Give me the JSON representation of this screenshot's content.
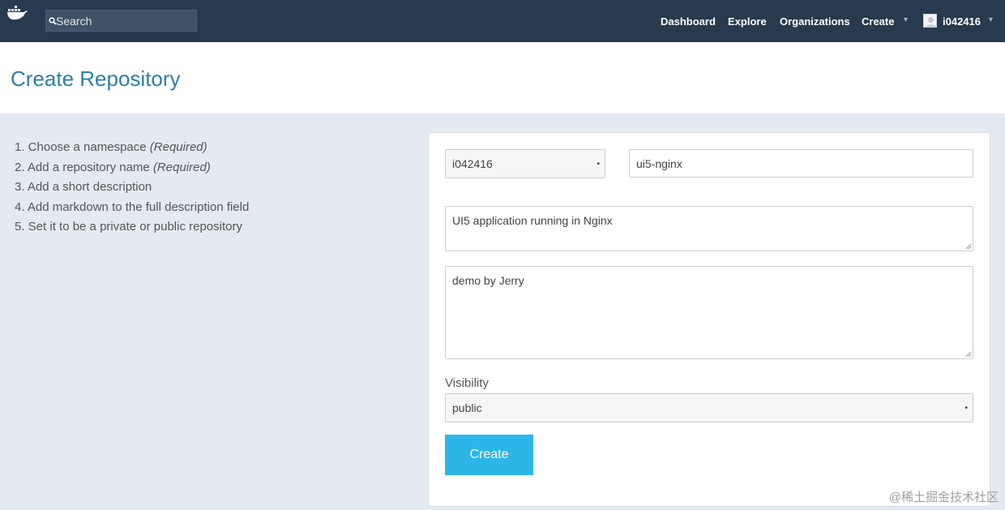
{
  "navbar": {
    "search_placeholder": "Search",
    "links": {
      "dashboard": "Dashboard",
      "explore": "Explore",
      "organizations": "Organizations",
      "create": "Create"
    },
    "username": "i042416"
  },
  "header": {
    "title": "Create Repository"
  },
  "steps": [
    {
      "text": "1. Choose a namespace ",
      "tag": "(Required)"
    },
    {
      "text": "2. Add a repository name ",
      "tag": "(Required)"
    },
    {
      "text": "3. Add a short description",
      "tag": ""
    },
    {
      "text": "4. Add markdown to the full description field",
      "tag": ""
    },
    {
      "text": "5. Set it to be a private or public repository",
      "tag": ""
    }
  ],
  "form": {
    "namespace": "i042416",
    "repo_name": "ui5-nginx",
    "short_description": "UI5 application running in Nginx",
    "full_description": "demo by Jerry",
    "visibility_label": "Visibility",
    "visibility": "public",
    "submit_label": "Create"
  },
  "watermark": "@稀土掘金技术社区",
  "colors": {
    "navbar": "#273a4e",
    "title": "#2d7fa6",
    "button": "#2cb6e8",
    "background": "#e4eaf1"
  }
}
